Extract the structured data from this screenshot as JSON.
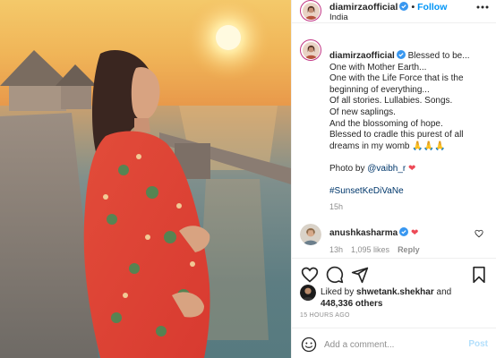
{
  "post": {
    "username": "diamirzaofficial",
    "follow_label": "Follow",
    "location": "India",
    "separator": "•"
  },
  "caption": {
    "username": "diamirzaofficial",
    "text": "Blessed to be...\nOne with Mother Earth...\nOne with the Life Force that is the beginning of everything...\nOf all stories. Lullabies. Songs.\nOf new saplings.\nAnd the blossoming of hope.\nBlessed to cradle this purest of all dreams in my womb 🙏🙏🙏\n\nPhoto by ",
    "mention": "@vaibh_r",
    "heart": "❤",
    "hashtag": "#SunsetKeDiVaNe",
    "time": "15h"
  },
  "comment": {
    "username": "anushkasharma",
    "text": "❤",
    "time": "13h",
    "likes": "1,095 likes",
    "reply": "Reply"
  },
  "likes": {
    "prefix": "Liked by ",
    "user": "shwetank.shekhar",
    "mid": " and",
    "count": "448,336 others"
  },
  "timestamp": "15 HOURS AGO",
  "add_comment": {
    "placeholder": "Add a comment...",
    "post_label": "Post"
  },
  "icons": [
    "more-icon",
    "verified-icon",
    "heart-icon",
    "comment-icon",
    "share-icon",
    "bookmark-icon",
    "emoji-icon"
  ],
  "colors": {
    "link": "#0095f6",
    "mention": "#00376b",
    "muted": "#8e8e8e",
    "heart": "#ed4956",
    "post_disabled": "#b2dffc"
  }
}
